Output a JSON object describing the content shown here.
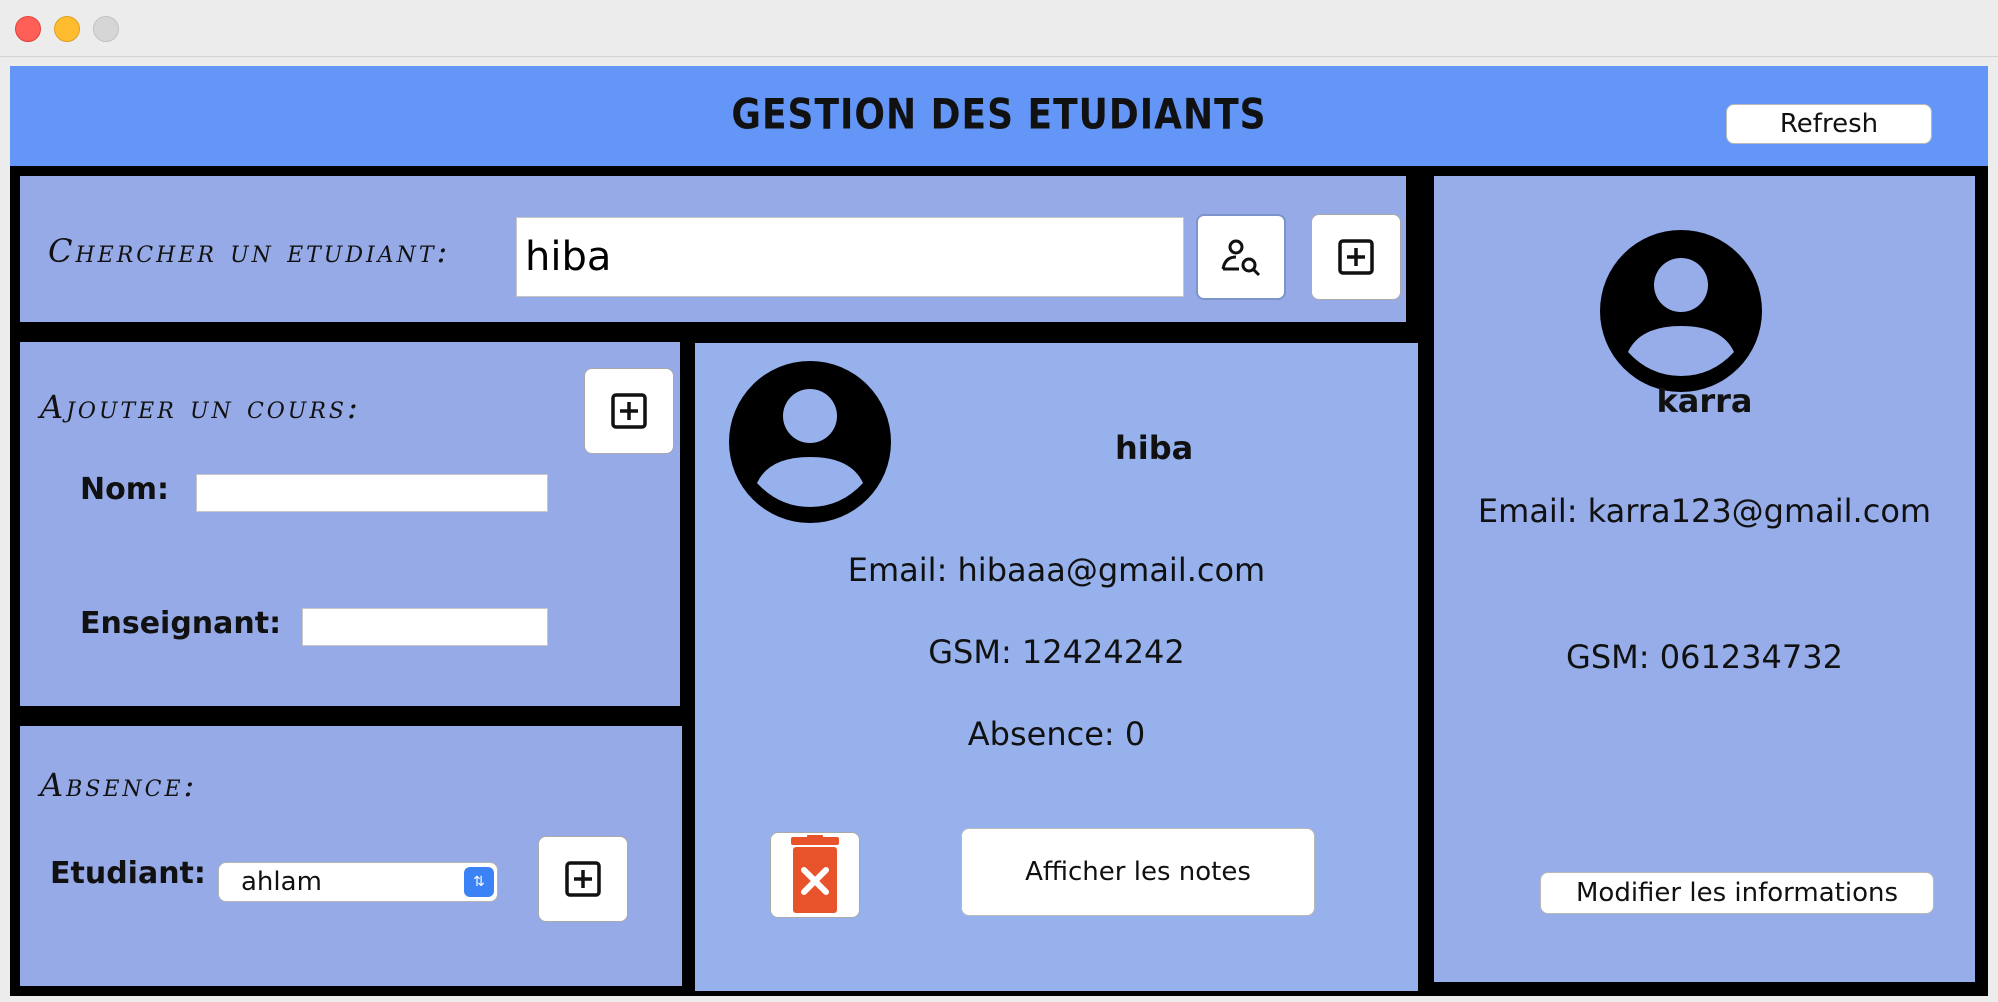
{
  "header": {
    "title": "GESTION DES ETUDIANTS",
    "refresh_label": "Refresh"
  },
  "search": {
    "label": "Chercher un etudiant:",
    "value": "hiba",
    "search_icon": "user-search-icon",
    "add_icon": "plus-square-icon"
  },
  "course": {
    "label": "Ajouter un cours:",
    "nom_label": "Nom:",
    "nom_value": "",
    "enseignant_label": "Enseignant:",
    "enseignant_value": ""
  },
  "absence": {
    "label": "Absence:",
    "etudiant_label": "Etudiant:",
    "selected": "ahlam"
  },
  "student": {
    "name": "hiba",
    "email": "Email: hibaaa@gmail.com",
    "gsm": "GSM: 12424242",
    "absence": "Absence: 0",
    "notes_label": "Afficher les notes"
  },
  "profile": {
    "name": "karra",
    "email": "Email: karra123@gmail.com",
    "gsm": "GSM: 061234732",
    "modify_label": "Modifier les informations"
  },
  "colors": {
    "header": "#6396f6",
    "panel": "#95aae6",
    "delete": "#e8532b"
  }
}
